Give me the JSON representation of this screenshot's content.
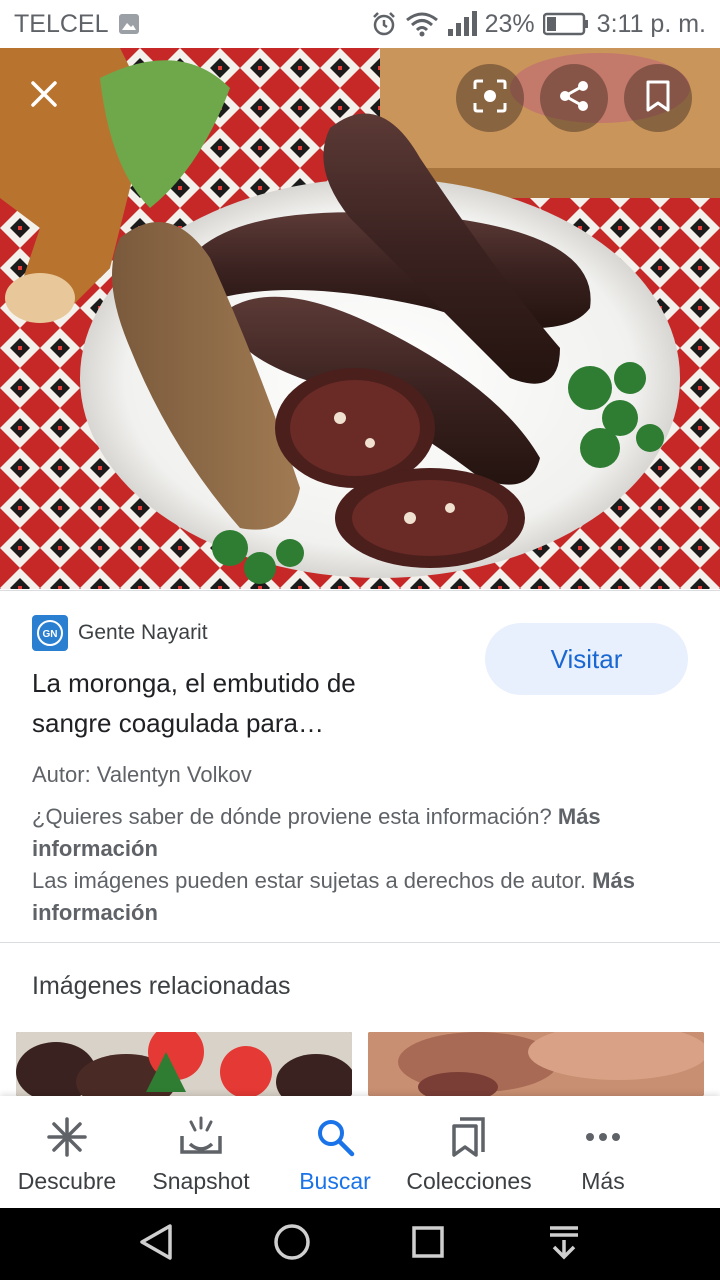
{
  "status_bar": {
    "carrier": "TELCEL",
    "battery": "23%",
    "time": "3:11 p. m."
  },
  "hero": {
    "icons": [
      "close-icon",
      "lens-icon",
      "share-icon",
      "bookmark-icon"
    ]
  },
  "result": {
    "source_name": "Gente Nayarit",
    "source_logo_text": "GN",
    "title": "La moronga, el embutido de sangre coagulada para…",
    "visit_label": "Visitar",
    "author": "Autor: Valentyn Volkov",
    "info_question": "¿Quieres saber de dónde proviene esta información?",
    "info_link": "Más información",
    "copyright_text": "Las imágenes pueden estar sujetas a derechos de autor.",
    "copyright_link": "Más información"
  },
  "related": {
    "heading": "Imágenes relacionadas"
  },
  "bottom_nav": {
    "items": [
      {
        "label": "Descubre",
        "icon": "asterisk-icon"
      },
      {
        "label": "Snapshot",
        "icon": "snapshot-icon"
      },
      {
        "label": "Buscar",
        "icon": "search-icon"
      },
      {
        "label": "Colecciones",
        "icon": "collections-icon"
      },
      {
        "label": "Más",
        "icon": "more-icon"
      }
    ],
    "active": "Buscar"
  },
  "colors": {
    "accent": "#1a73e8",
    "visit_bg": "#e8f0fe",
    "visit_text": "#1967d2"
  }
}
